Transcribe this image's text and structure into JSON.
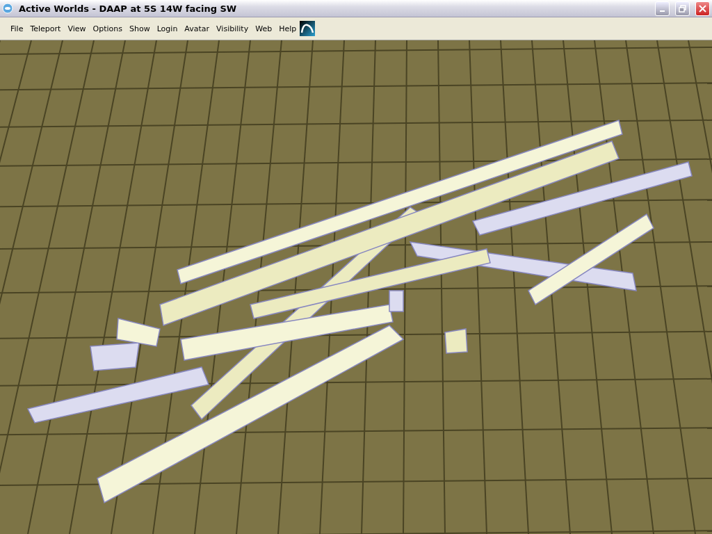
{
  "window": {
    "title": "Active Worlds - DAAP at 5S 14W facing SW"
  },
  "menu": [
    "File",
    "Teleport",
    "View",
    "Options",
    "Show",
    "Login",
    "Avatar",
    "Visibility",
    "Web",
    "Help"
  ]
}
